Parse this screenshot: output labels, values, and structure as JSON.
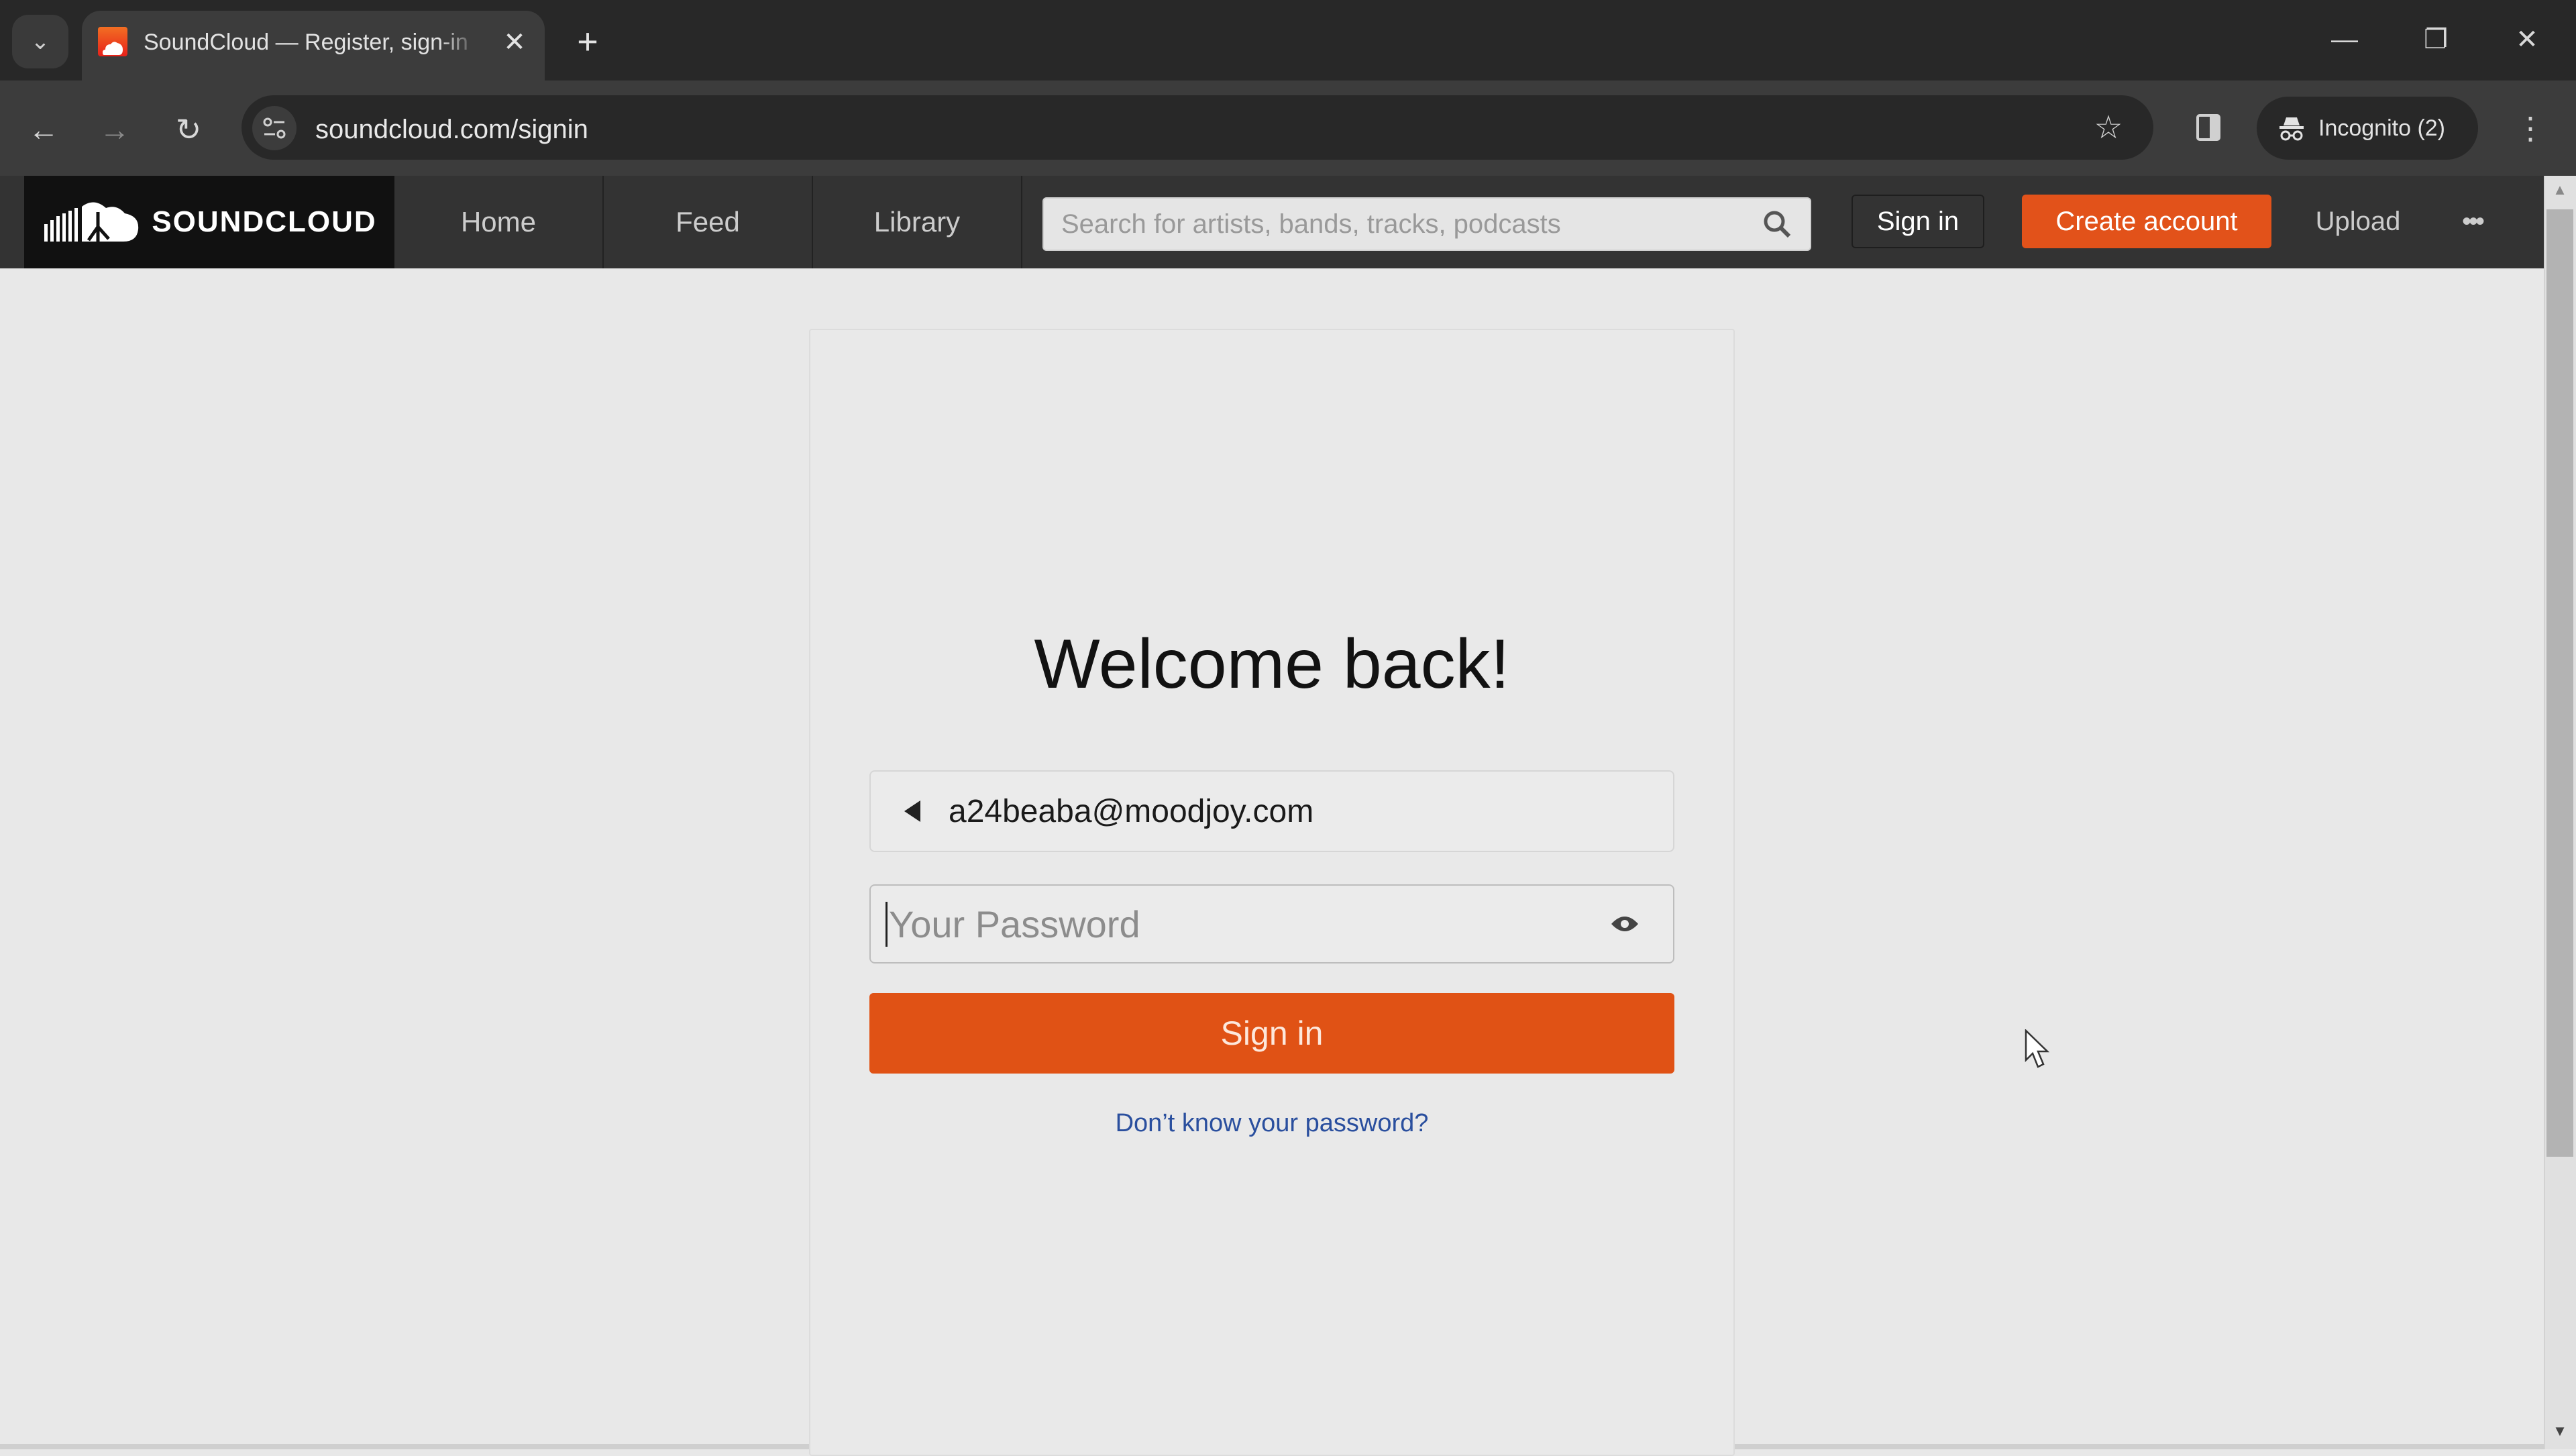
{
  "browser": {
    "tab": {
      "title": "SoundCloud — Register, sign-in",
      "favicon": "soundcloud-favicon"
    },
    "new_tab_label": "+",
    "address": "soundcloud.com/signin",
    "incognito_label": "Incognito (2)",
    "icons": {
      "tab_search": "chevron-down-icon",
      "close_tab": "close-icon",
      "minimize": "minimize-icon",
      "restore": "restore-icon",
      "close_window": "close-icon",
      "back": "back-arrow-icon",
      "forward": "forward-arrow-icon",
      "reload": "reload-icon",
      "site_info": "tune-icon",
      "bookmark": "star-icon",
      "side_panel": "side-panel-icon",
      "menu": "kebab-menu-icon"
    }
  },
  "site_header": {
    "logo_text": "SOUNDCLOUD",
    "nav": [
      {
        "label": "Home"
      },
      {
        "label": "Feed"
      },
      {
        "label": "Library"
      }
    ],
    "search": {
      "placeholder": "Search for artists, bands, tracks, podcasts",
      "value": ""
    },
    "sign_in_label": "Sign in",
    "create_account_label": "Create account",
    "upload_label": "Upload",
    "more_label": "•••",
    "colors": {
      "accent": "#e2521a",
      "header_bg": "#333333",
      "logo_bg": "#111111"
    }
  },
  "signin_card": {
    "heading": "Welcome back!",
    "email": "a24beaba@moodjoy.com",
    "password": {
      "placeholder": "Your Password",
      "value": ""
    },
    "submit_label": "Sign in",
    "forgot_link": "Don’t know your password?",
    "colors": {
      "button": "#e05215",
      "link": "#2a4f9e"
    }
  }
}
